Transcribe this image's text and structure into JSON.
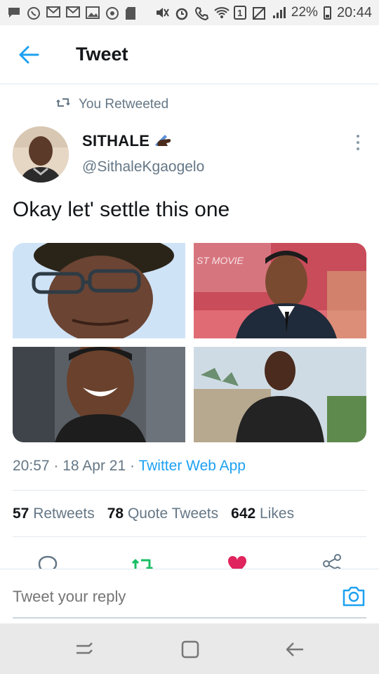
{
  "status_bar": {
    "battery": "22%",
    "time": "20:44",
    "sim": "1"
  },
  "header": {
    "title": "Tweet",
    "back_icon": "back-arrow-icon"
  },
  "retweet_notice": {
    "label": "You Retweeted",
    "icon": "retweet-icon"
  },
  "author": {
    "name": "SITHALE",
    "name_emoji": "writing-hand-icon",
    "handle": "@SithaleKgaogelo"
  },
  "tweet": {
    "text": "Okay let' settle this one",
    "media": [
      {
        "label": "photo-1"
      },
      {
        "label": "photo-2"
      },
      {
        "label": "photo-3"
      },
      {
        "label": "photo-4"
      }
    ]
  },
  "meta": {
    "time": "20:57",
    "date": "18 Apr 21",
    "app": "Twitter Web App",
    "sep": "·"
  },
  "stats": {
    "retweets_count": "57",
    "retweets_label": "Retweets",
    "quotes_count": "78",
    "quotes_label": "Quote Tweets",
    "likes_count": "642",
    "likes_label": "Likes"
  },
  "reply": {
    "placeholder": "Tweet your reply"
  },
  "colors": {
    "accent": "#1da1f2",
    "retweet_green": "#17bf63",
    "like_red": "#e0245e",
    "secondary_text": "#657786"
  }
}
